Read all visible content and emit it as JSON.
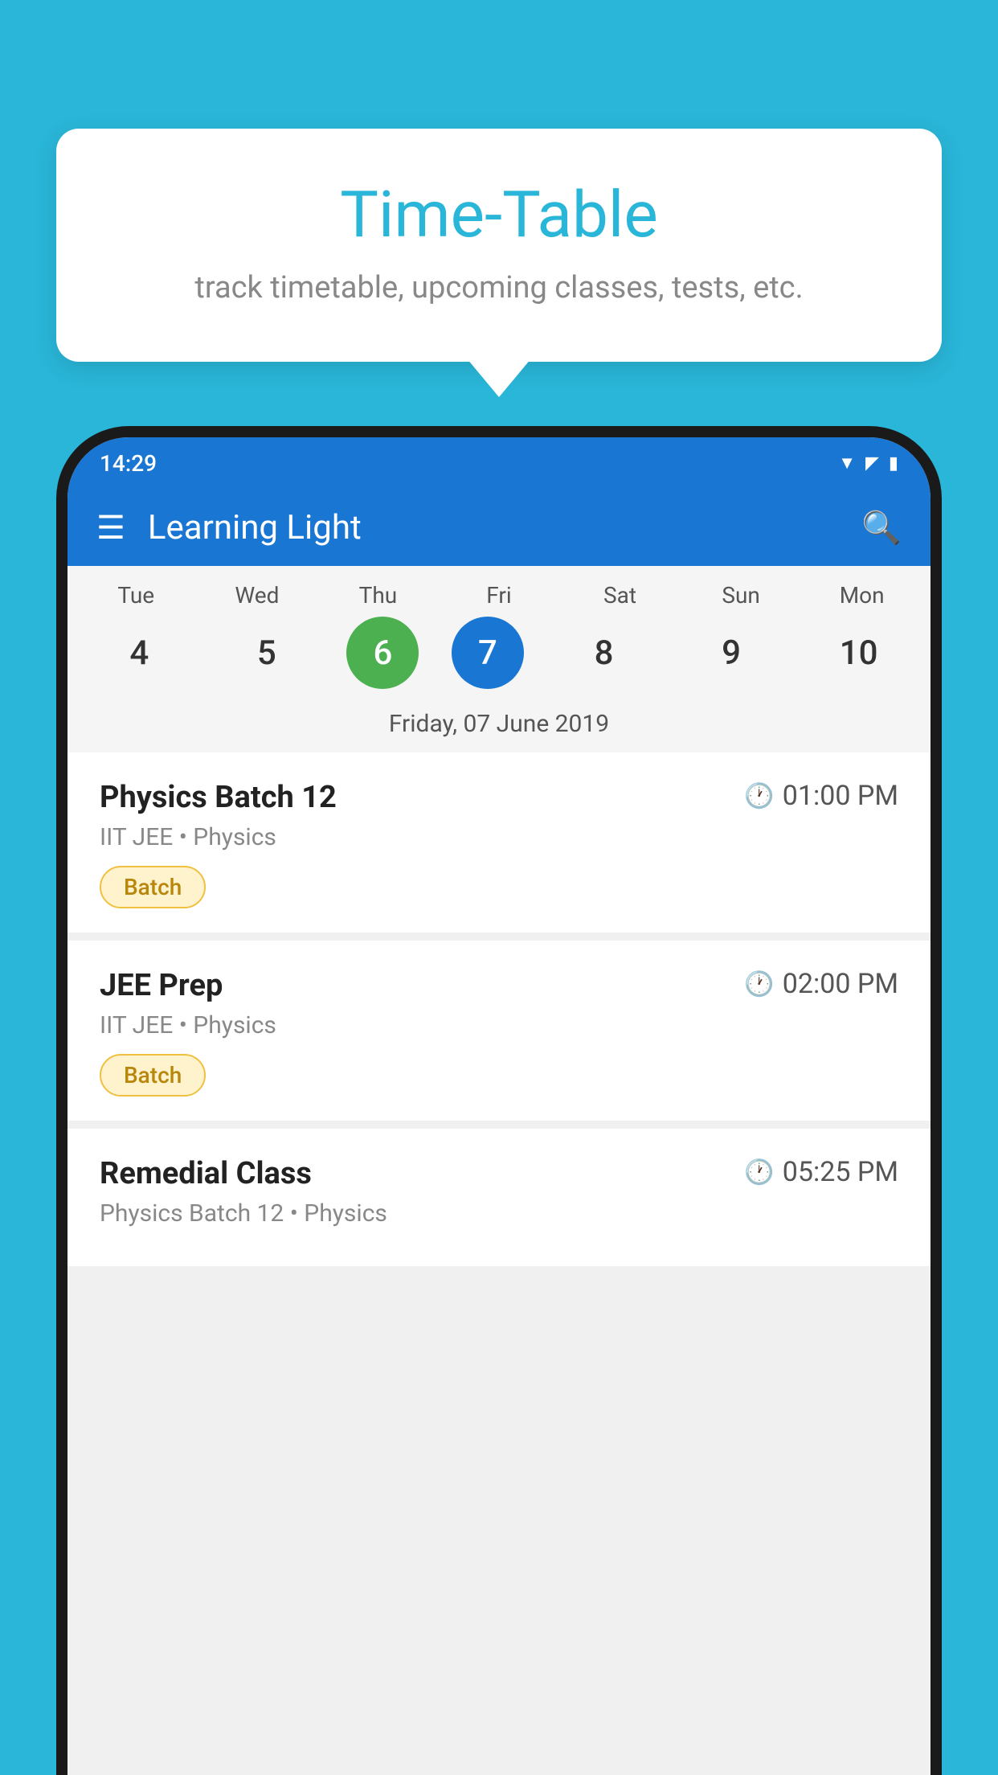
{
  "background_color": "#29b6d8",
  "tooltip": {
    "title": "Time-Table",
    "subtitle": "track timetable, upcoming classes, tests, etc."
  },
  "phone": {
    "status_bar": {
      "time": "14:29"
    },
    "app_bar": {
      "title": "Learning Light"
    },
    "calendar": {
      "days": [
        {
          "label": "Tue",
          "number": "4"
        },
        {
          "label": "Wed",
          "number": "5"
        },
        {
          "label": "Thu",
          "number": "6",
          "state": "today"
        },
        {
          "label": "Fri",
          "number": "7",
          "state": "selected"
        },
        {
          "label": "Sat",
          "number": "8"
        },
        {
          "label": "Sun",
          "number": "9"
        },
        {
          "label": "Mon",
          "number": "10"
        }
      ],
      "selected_date_label": "Friday, 07 June 2019"
    },
    "classes": [
      {
        "name": "Physics Batch 12",
        "time": "01:00 PM",
        "subject": "IIT JEE • Physics",
        "badge": "Batch"
      },
      {
        "name": "JEE Prep",
        "time": "02:00 PM",
        "subject": "IIT JEE • Physics",
        "badge": "Batch"
      },
      {
        "name": "Remedial Class",
        "time": "05:25 PM",
        "subject": "Physics Batch 12 • Physics",
        "badge": ""
      }
    ]
  }
}
